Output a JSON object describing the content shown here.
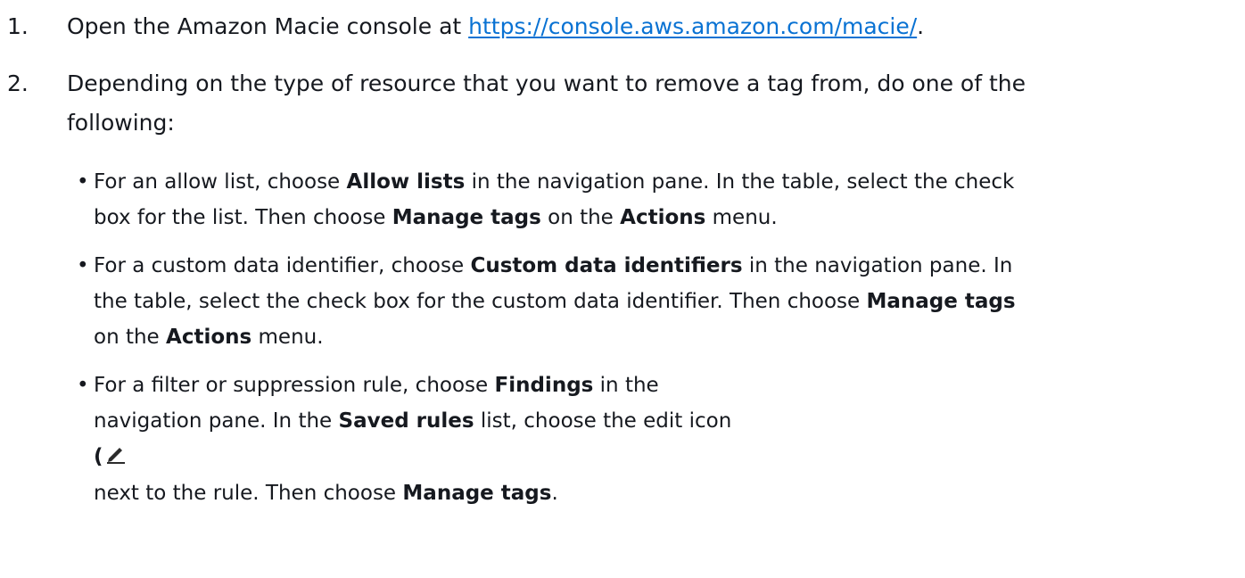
{
  "steps": [
    {
      "number": "1.",
      "text_before": "Open the Amazon Macie console at ",
      "link": "https://console.aws.amazon.com/macie/",
      "text_after": "."
    },
    {
      "number": "2.",
      "line1": "Depending on the type of resource that you want to remove a tag from, do one of the",
      "line2": "following:"
    }
  ],
  "bullets": [
    {
      "l1_a": "For an allow list, choose ",
      "l1_b": "Allow lists",
      "l1_c": " in the navigation pane. In the table, select the check",
      "l2_a": "box for the list. Then choose ",
      "l2_b": "Manage tags",
      "l2_c": " on the ",
      "l2_d": "Actions",
      "l2_e": " menu."
    },
    {
      "l1_a": "For a custom data identifier, choose ",
      "l1_b": "Custom data identifiers",
      "l1_c": " in the navigation pane. In",
      "l2_a": "the table, select the check box for the custom data identifier. Then choose ",
      "l2_b": "Manage tags",
      "l3_a": "on the ",
      "l3_b": "Actions",
      "l3_c": " menu."
    },
    {
      "l1_a": "For a filter or suppression rule, choose ",
      "l1_b": "Findings",
      "l1_c": " in the",
      "l2_a": "navigation pane. In the ",
      "l2_b": "Saved rules",
      "l2_c": " list, choose the edit icon",
      "l3_paren": "(",
      "l4_a": "next to the rule. Then choose ",
      "l4_b": "Manage tags",
      "l4_c": "."
    }
  ],
  "bullet_char": "•",
  "colors": {
    "text": "#16191f",
    "link": "#0972d3"
  },
  "icons": {
    "edit": "pencil-edit-icon"
  }
}
